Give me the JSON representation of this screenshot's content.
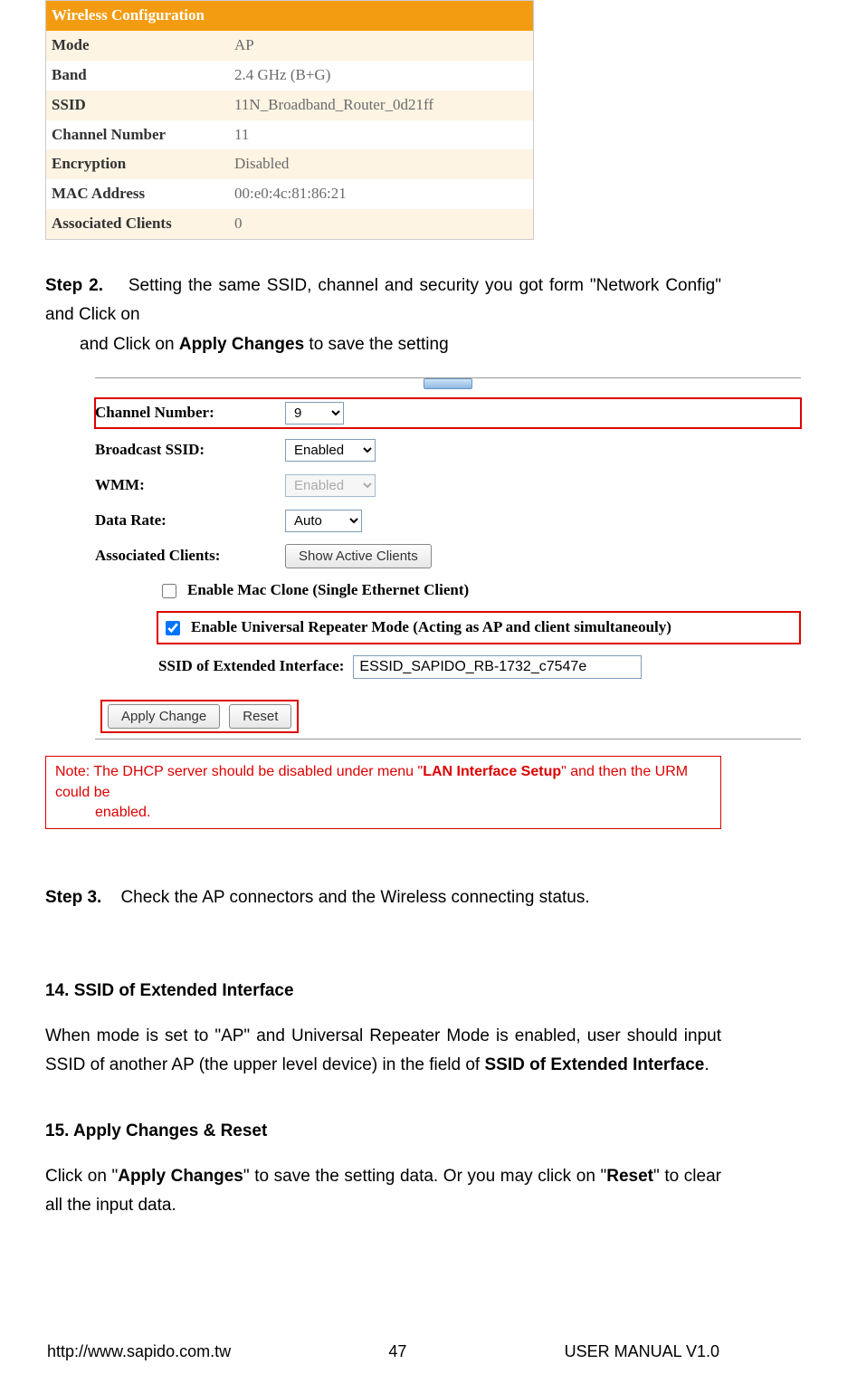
{
  "wireless": {
    "header": "Wireless Configuration",
    "rows": [
      {
        "label": "Mode",
        "value": "AP"
      },
      {
        "label": "Band",
        "value": "2.4 GHz (B+G)"
      },
      {
        "label": "SSID",
        "value": "11N_Broadband_Router_0d21ff"
      },
      {
        "label": "Channel Number",
        "value": "11"
      },
      {
        "label": "Encryption",
        "value": "Disabled"
      },
      {
        "label": "MAC Address",
        "value": "00:e0:4c:81:86:21"
      },
      {
        "label": "Associated Clients",
        "value": "0"
      }
    ]
  },
  "step2": {
    "label": "Step 2.",
    "text_a": "Setting the same SSID, channel and security you got form \"Network Config\" and Click on ",
    "bold": "Apply Changes",
    "text_b": " to save the setting"
  },
  "config": {
    "channel_label": "Channel Number:",
    "channel_value": "9",
    "broadcast_label": "Broadcast SSID:",
    "broadcast_value": "Enabled",
    "wmm_label": "WMM:",
    "wmm_value": "Enabled",
    "datarate_label": "Data Rate:",
    "datarate_value": "Auto",
    "assoc_label": "Associated Clients:",
    "assoc_btn": "Show Active Clients",
    "mac_clone_label": "Enable Mac Clone (Single Ethernet Client)",
    "urm_label": "Enable Universal Repeater Mode (Acting as AP and client simultaneouly)",
    "ssid_ext_label": "SSID of Extended Interface:",
    "ssid_ext_value": "ESSID_SAPIDO_RB-1732_c7547e",
    "apply_btn": "Apply Change",
    "reset_btn": "Reset"
  },
  "note": {
    "prefix": "Note: The DHCP server should be disabled under menu \"",
    "bold": "LAN Interface Setup",
    "suffix1": "\" and then the URM could be",
    "suffix2": "enabled."
  },
  "step3": {
    "label": "Step 3.",
    "text": "Check the AP connectors and the Wireless connecting status."
  },
  "section14": {
    "heading": "14.  SSID of Extended Interface",
    "text_a": "When mode is set to \"AP\" and Universal Repeater Mode is enabled, user should input SSID of another AP (the upper level device) in the field of ",
    "bold": "SSID of Extended Interface",
    "text_b": "."
  },
  "section15": {
    "heading": "15.  Apply Changes & Reset",
    "text_a": "Click on \"",
    "bold1": "Apply Changes",
    "text_b": "\" to save the setting data. Or you may click on \"",
    "bold2": "Reset",
    "text_c": "\" to clear all the input data."
  },
  "footer": {
    "url": "http://www.sapido.com.tw",
    "page": "47",
    "manual": "USER MANUAL V1.0"
  }
}
